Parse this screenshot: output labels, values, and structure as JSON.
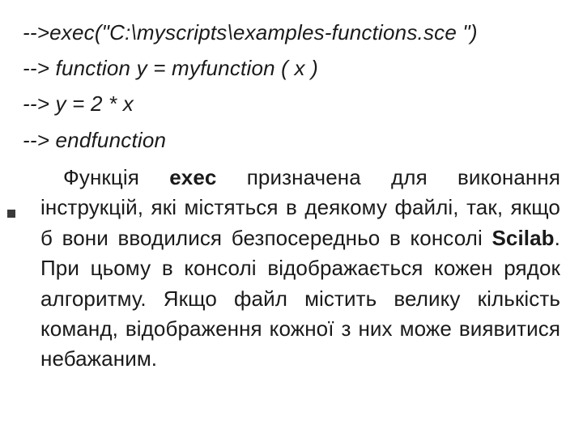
{
  "code": {
    "l1": "-->exec(\"C:\\myscripts\\examples-functions.sce \")",
    "l2": "--> function y = myfunction ( x )",
    "l3": "--> y = 2 * x",
    "l4": "--> endfunction"
  },
  "para": {
    "seg1": "Функція ",
    "b1": "exec",
    "seg2": " призначена для виконання інструкцій, які містяться в деякому файлі, так,  якщо б вони вводилися безпосередньо в консолі ",
    "b2": "Scilab",
    "seg3": ". При цьому в консолі відображається кожен рядок алгоритму. Якщо файл містить велику кількість команд, відображення кожної з них може виявитися небажаним."
  }
}
